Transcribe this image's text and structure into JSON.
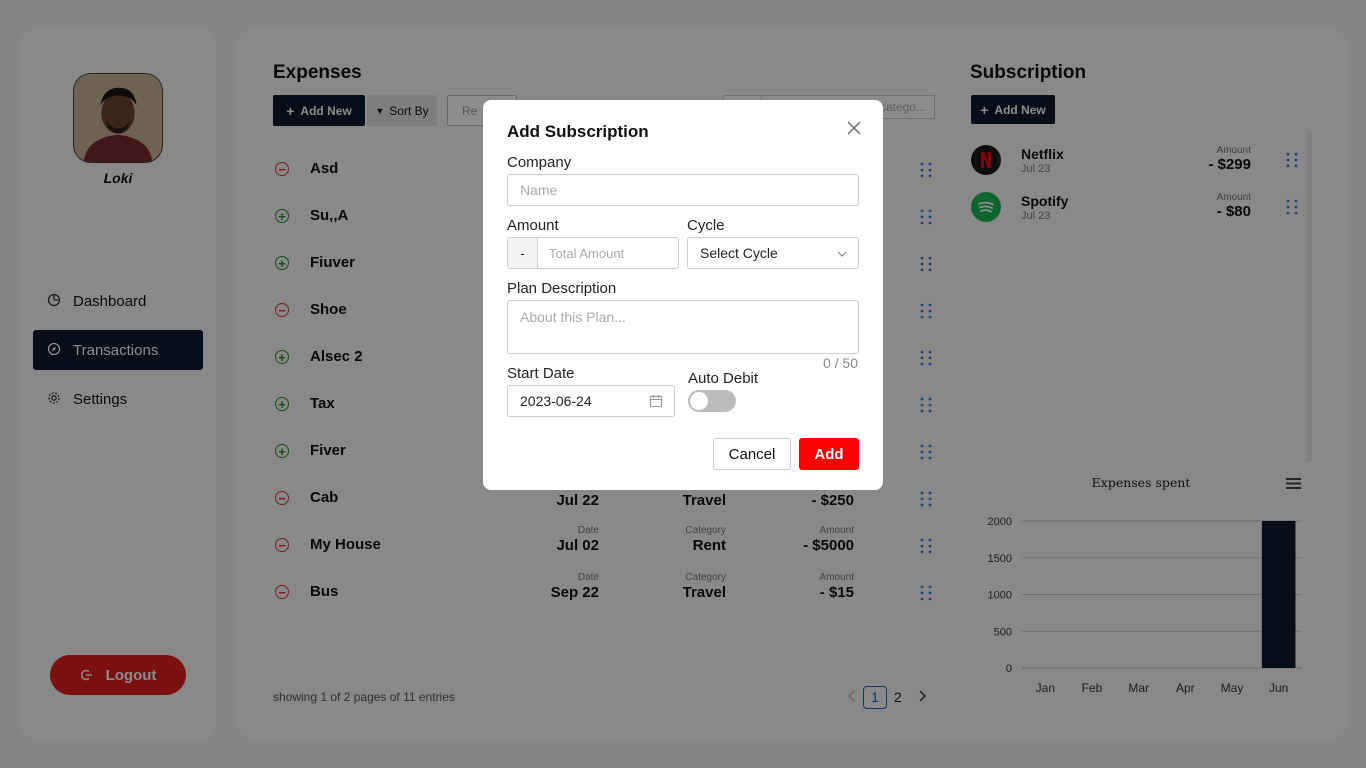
{
  "sidebar": {
    "username": "Loki",
    "nav": [
      {
        "label": "Dashboard",
        "icon": "pie-chart-icon"
      },
      {
        "label": "Transactions",
        "icon": "compass-icon"
      },
      {
        "label": "Settings",
        "icon": "gear-icon"
      }
    ],
    "logout_label": "Logout"
  },
  "expenses": {
    "title": "Expenses",
    "add_new_label": "Add New",
    "sort_by_label": "Sort By",
    "reset_label": "Re",
    "search_placeholder": "catego...",
    "rows": [
      {
        "name": "Asd",
        "type": "minus"
      },
      {
        "name": "Su,,A",
        "type": "plus"
      },
      {
        "name": "Fiuver",
        "type": "plus"
      },
      {
        "name": "Shoe",
        "type": "minus"
      },
      {
        "name": "Alsec 2",
        "type": "plus"
      },
      {
        "name": "Tax",
        "type": "plus"
      },
      {
        "name": "Fiver",
        "type": "plus"
      },
      {
        "name": "Cab",
        "type": "minus",
        "date": "Jul 22",
        "category": "Travel",
        "amount": "- $250"
      },
      {
        "name": "My House",
        "type": "minus",
        "date_label": "Date",
        "date": "Jul 02",
        "category_label": "Category",
        "category": "Rent",
        "amount_label": "Amount",
        "amount": "- $5000"
      },
      {
        "name": "Bus",
        "type": "minus",
        "date_label": "Date",
        "date": "Sep 22",
        "category_label": "Category",
        "category": "Travel",
        "amount_label": "Amount",
        "amount": "- $15"
      }
    ],
    "pager_info": "showing 1 of 2 pages of 11 entries",
    "pages": [
      "1",
      "2"
    ],
    "current_page": "1"
  },
  "subscription": {
    "title": "Subscription",
    "add_new_label": "Add New",
    "items": [
      {
        "name": "Netflix",
        "date": "Jul 23",
        "amount_label": "Amount",
        "amount": "- $299",
        "icon": "netflix-logo-icon",
        "color": "#1a1a1a"
      },
      {
        "name": "Spotify",
        "date": "Jul 23",
        "amount_label": "Amount",
        "amount": "- $80",
        "icon": "spotify-logo-icon",
        "color": "#1db954"
      }
    ]
  },
  "chart_data": {
    "type": "bar",
    "title": "Expenses spent",
    "categories": [
      "Jan",
      "Feb",
      "Mar",
      "Apr",
      "May",
      "Jun"
    ],
    "values": [
      0,
      0,
      0,
      0,
      0,
      2000
    ],
    "yticks": [
      "0",
      "500",
      "1000",
      "1500",
      "2000"
    ],
    "ylim": [
      0,
      2000
    ],
    "grid": true
  },
  "modal": {
    "title": "Add Subscription",
    "company_label": "Company",
    "company_placeholder": "Name",
    "amount_label": "Amount",
    "amount_sign": "-",
    "amount_placeholder": "Total Amount",
    "cycle_label": "Cycle",
    "cycle_value": "Select Cycle",
    "plan_label": "Plan Description",
    "plan_placeholder": "About this Plan...",
    "plan_counter": "0 / 50",
    "start_date_label": "Start Date",
    "start_date_value": "2023-06-24",
    "auto_debit_label": "Auto Debit",
    "auto_debit_on": false,
    "cancel_label": "Cancel",
    "add_label": "Add"
  },
  "colors": {
    "navy": "#0d1b2e",
    "danger": "#e01e1e",
    "add_button": "#ff0000"
  }
}
